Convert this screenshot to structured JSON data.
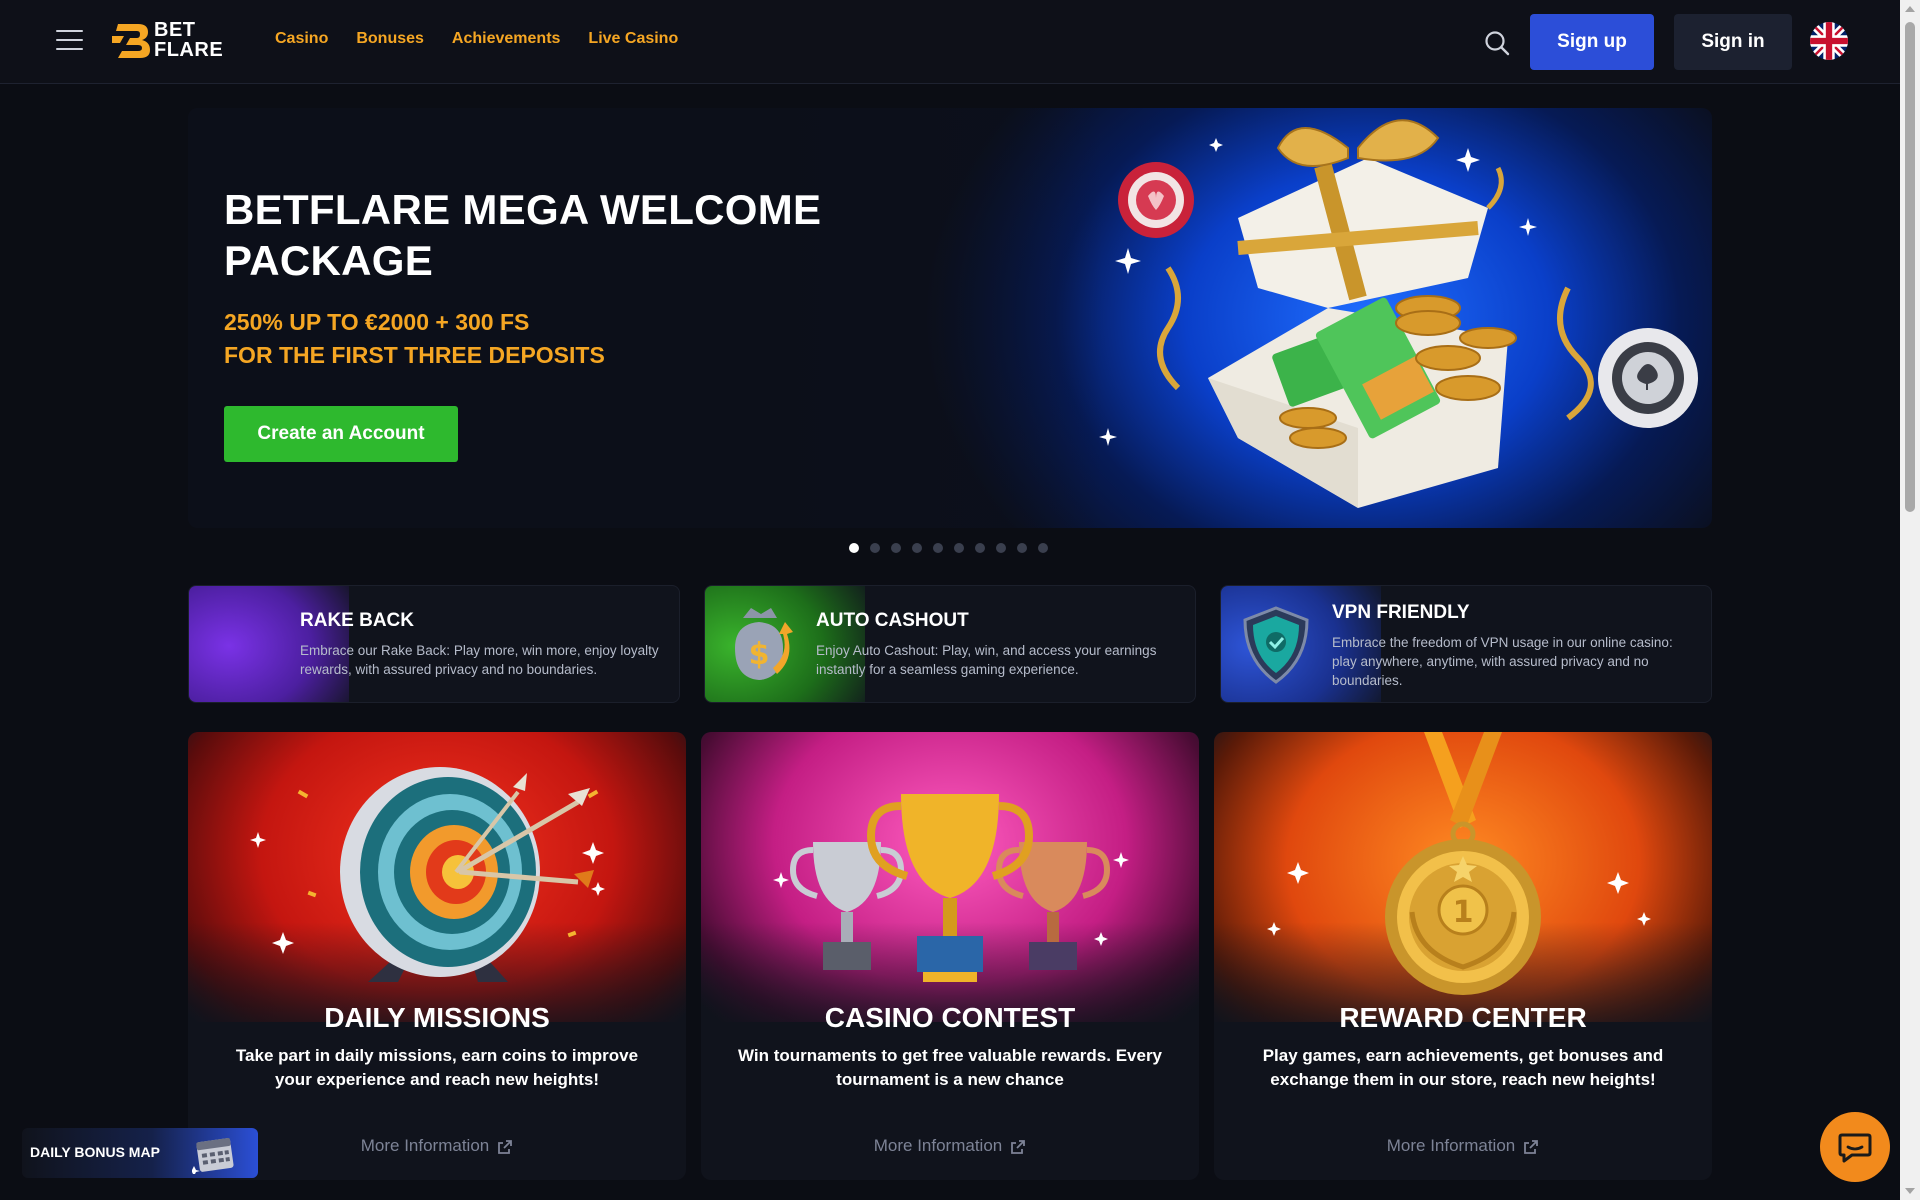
{
  "header": {
    "logo_line1": "BET",
    "logo_line2": "FLARE",
    "nav": [
      "Casino",
      "Bonuses",
      "Achievements",
      "Live Casino"
    ],
    "signup_label": "Sign up",
    "signin_label": "Sign in",
    "language_flag": "uk-flag-icon"
  },
  "hero": {
    "title": "BETFLARE MEGA WELCOME PACKAGE",
    "subtitle_line1": "250% UP TO €2000 + 300 FS",
    "subtitle_line2": "FOR THE FIRST THREE DEPOSITS",
    "cta_label": "Create an Account",
    "slide_count": 10,
    "active_slide": 1
  },
  "features": [
    {
      "title": "RAKE BACK",
      "description": "Embrace our Rake Back: Play more, win more, enjoy loyalty rewards, with assured privacy and no boundaries.",
      "color": "#6a2cd8"
    },
    {
      "title": "AUTO CASHOUT",
      "description": "Enjoy Auto Cashout: Play, win, and access your earnings instantly for a seamless gaming experience.",
      "color": "#2d9a27"
    },
    {
      "title": "VPN FRIENDLY",
      "description": "Embrace the freedom of VPN usage in our online casino: play anywhere, anytime, with assured privacy and no boundaries.",
      "color": "#2040b8"
    }
  ],
  "cards": [
    {
      "title": "DAILY MISSIONS",
      "description": "Take part in daily missions, earn coins to improve your experience and reach new heights!",
      "more": "More Information",
      "color": "#e0241a"
    },
    {
      "title": "CASINO CONTEST",
      "description": "Win tournaments to get free valuable rewards. Every tournament is a new chance",
      "more": "More Information",
      "color": "#e23a9c"
    },
    {
      "title": "REWARD CENTER",
      "description": "Play games, earn achievements, get bonuses and exchange them in our store, reach new heights!",
      "more": "More Information",
      "color": "#f06018"
    }
  ],
  "daily_bonus": {
    "label": "DAILY BONUS MAP"
  },
  "colors": {
    "accent": "#f5a623",
    "primary": "#2c4ed8",
    "cta": "#2eb92e",
    "chat": "#f28a1c"
  }
}
